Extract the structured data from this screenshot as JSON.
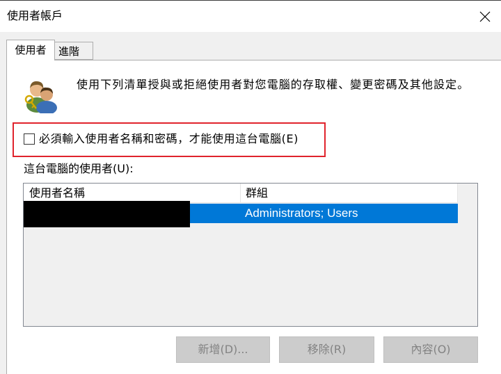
{
  "window": {
    "title": "使用者帳戶"
  },
  "tabs": [
    {
      "label": "使用者",
      "active": true
    },
    {
      "label": "進階",
      "active": false
    }
  ],
  "main": {
    "description": "使用下列清單授與或拒絕使用者對您電腦的存取權、變更密碼及其他設定。",
    "require_login_checkbox": {
      "label": "必須輸入使用者名稱和密碼，才能使用這台電腦(E)",
      "checked": false
    },
    "users_label": "這台電腦的使用者(U):",
    "user_list": {
      "columns": [
        "使用者名稱",
        "群組"
      ],
      "rows": [
        {
          "name": "",
          "group": "Administrators; Users",
          "selected": true
        }
      ]
    },
    "buttons": {
      "add": "新增(D)...",
      "remove": "移除(R)",
      "properties": "內容(O)"
    }
  },
  "colors": {
    "selection": "#0078d7",
    "highlight_border": "#e0232c",
    "disabled_button": "#cccccc"
  },
  "icons": {
    "close": "close-icon",
    "users": "users-key-icon"
  }
}
